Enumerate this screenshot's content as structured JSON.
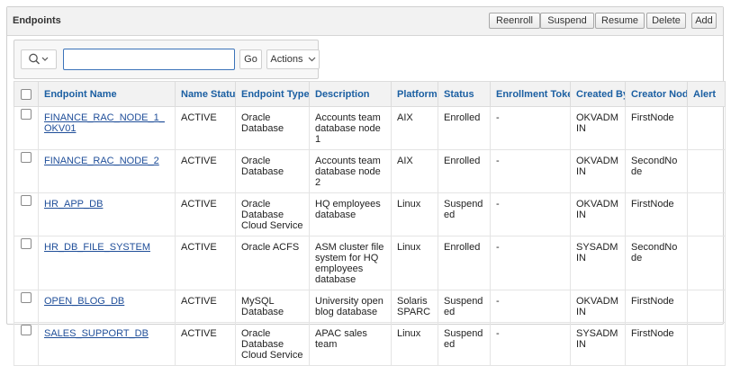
{
  "region": {
    "title": "Endpoints"
  },
  "header_buttons": {
    "reenroll": "Reenroll",
    "suspend": "Suspend",
    "resume": "Resume",
    "delete": "Delete",
    "add": "Add"
  },
  "toolbar": {
    "search_icon": "search-icon",
    "chevron_icon": "chevron-down-icon",
    "search_value": "",
    "go_label": "Go",
    "actions_label": "Actions"
  },
  "columns": [
    "Endpoint Name",
    "Name Status",
    "Endpoint Type",
    "Description",
    "Platform",
    "Status",
    "Enrollment Token",
    "Created By",
    "Creator Node",
    "Alert"
  ],
  "rows": [
    {
      "name": "FINANCE_RAC_NODE_1_OKV01",
      "name_status": "ACTIVE",
      "type": "Oracle Database",
      "description": "Accounts team database node 1",
      "platform": "AIX",
      "status": "Enrolled",
      "token": "-",
      "created_by": "OKVADMIN",
      "creator_node": "FirstNode",
      "alert": ""
    },
    {
      "name": "FINANCE_RAC_NODE_2",
      "name_status": "ACTIVE",
      "type": "Oracle Database",
      "description": "Accounts team database node 2",
      "platform": "AIX",
      "status": "Enrolled",
      "token": "-",
      "created_by": "OKVADMIN",
      "creator_node": "SecondNode",
      "alert": ""
    },
    {
      "name": "HR_APP_DB",
      "name_status": "ACTIVE",
      "type": "Oracle Database Cloud Service",
      "description": "HQ employees database",
      "platform": "Linux",
      "status": "Suspended",
      "token": "-",
      "created_by": "OKVADMIN",
      "creator_node": "FirstNode",
      "alert": ""
    },
    {
      "name": "HR_DB_FILE_SYSTEM",
      "name_status": "ACTIVE",
      "type": "Oracle ACFS",
      "description": "ASM cluster file system for HQ employees database",
      "platform": "Linux",
      "status": "Enrolled",
      "token": "-",
      "created_by": "SYSADMIN",
      "creator_node": "SecondNode",
      "alert": ""
    },
    {
      "name": "OPEN_BLOG_DB",
      "name_status": "ACTIVE",
      "type": "MySQL Database",
      "description": "University open blog database",
      "platform": "Solaris SPARC",
      "status": "Suspended",
      "token": "-",
      "created_by": "OKVADMIN",
      "creator_node": "FirstNode",
      "alert": ""
    },
    {
      "name": "SALES_SUPPORT_DB",
      "name_status": "ACTIVE",
      "type": "Oracle Database Cloud Service",
      "description": "APAC sales team",
      "platform": "Linux",
      "status": "Suspended",
      "token": "-",
      "created_by": "SYSADMIN",
      "creator_node": "FirstNode",
      "alert": ""
    }
  ],
  "colors": {
    "active": "#1e7b1e",
    "suspended": "#d4222a",
    "link": "#1f4e99",
    "header_text": "#1b5fa2"
  }
}
